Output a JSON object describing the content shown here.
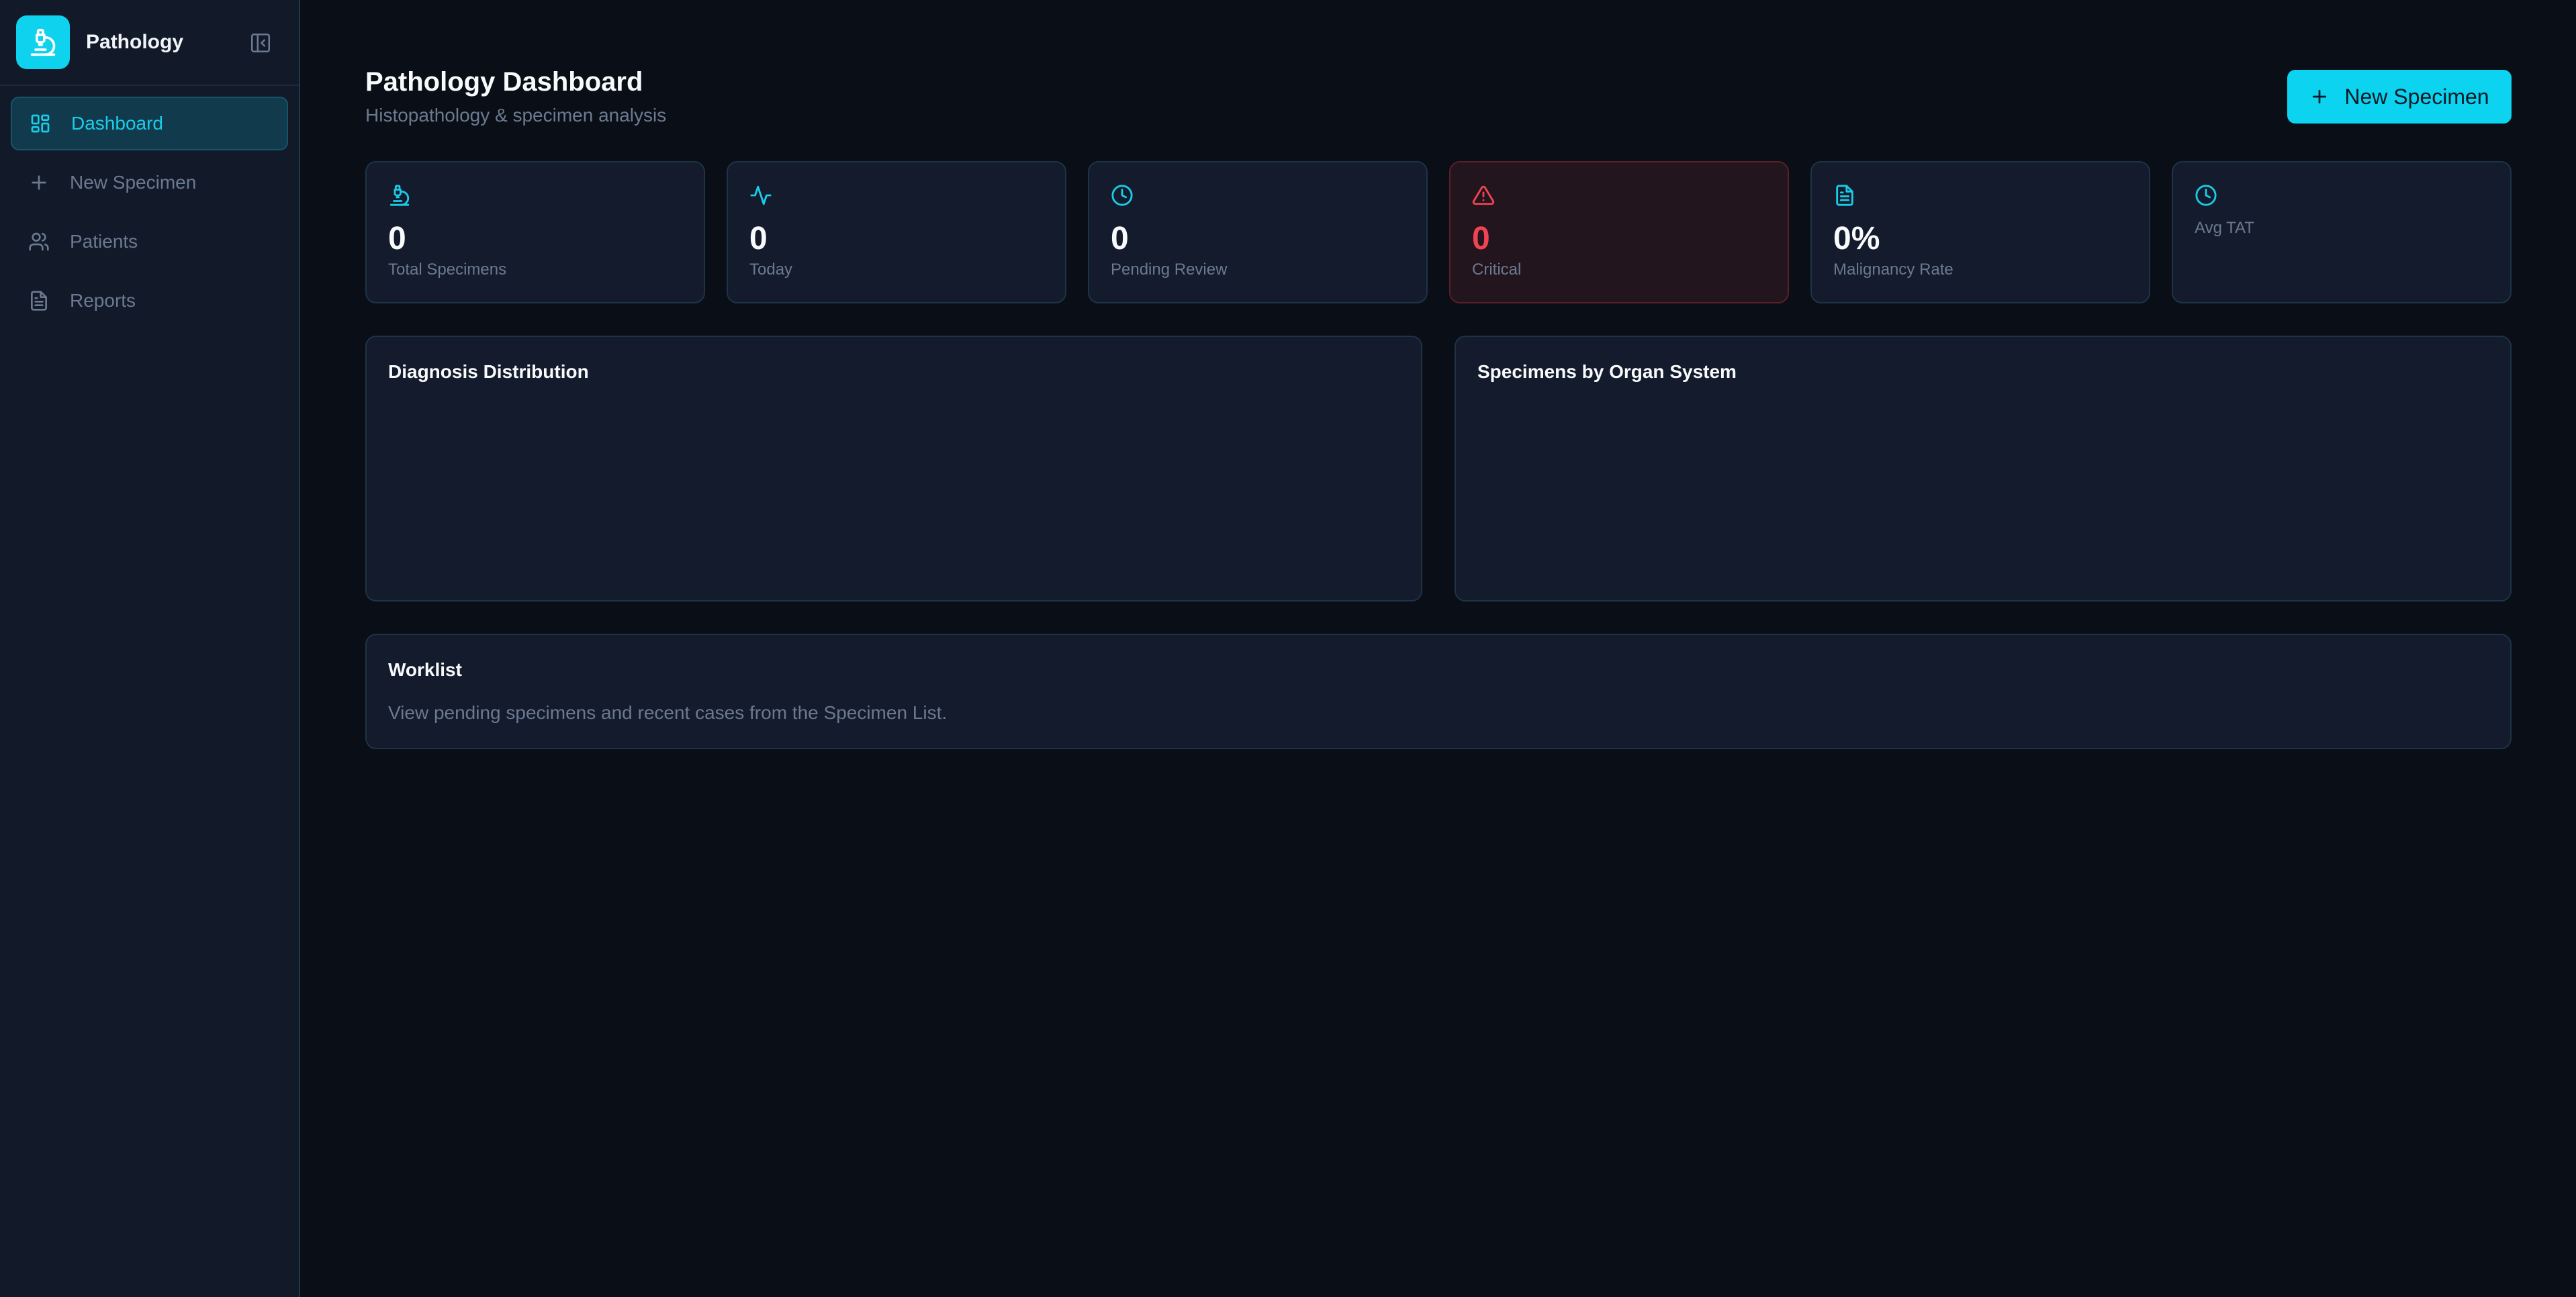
{
  "sidebar": {
    "app_name": "Pathology",
    "items": [
      {
        "label": "Dashboard",
        "icon": "dashboard-grid-icon",
        "active": true
      },
      {
        "label": "New Specimen",
        "icon": "plus-icon",
        "active": false
      },
      {
        "label": "Patients",
        "icon": "users-icon",
        "active": false
      },
      {
        "label": "Reports",
        "icon": "file-text-icon",
        "active": false
      }
    ]
  },
  "header": {
    "title": "Pathology Dashboard",
    "subtitle": "Histopathology & specimen analysis",
    "new_specimen_label": "New Specimen"
  },
  "stats": [
    {
      "value": "0",
      "label": "Total Specimens",
      "icon": "microscope-icon"
    },
    {
      "value": "0",
      "label": "Today",
      "icon": "activity-icon"
    },
    {
      "value": "0",
      "label": "Pending Review",
      "icon": "clock-icon"
    },
    {
      "value": "0",
      "label": "Critical",
      "icon": "alert-triangle-icon"
    },
    {
      "value": "0%",
      "label": "Malignancy Rate",
      "icon": "file-text-icon"
    },
    {
      "value": "",
      "label": "Avg TAT",
      "icon": "clock-icon"
    }
  ],
  "panels": {
    "diagnosis_title": "Diagnosis Distribution",
    "organ_title": "Specimens by Organ System",
    "worklist_title": "Worklist",
    "worklist_text": "View pending specimens and recent cases from the Specimen List."
  },
  "colors": {
    "accent": "#0bd3f0",
    "critical": "#f04452",
    "background": "#0a0e17",
    "card": "#131b2c"
  }
}
